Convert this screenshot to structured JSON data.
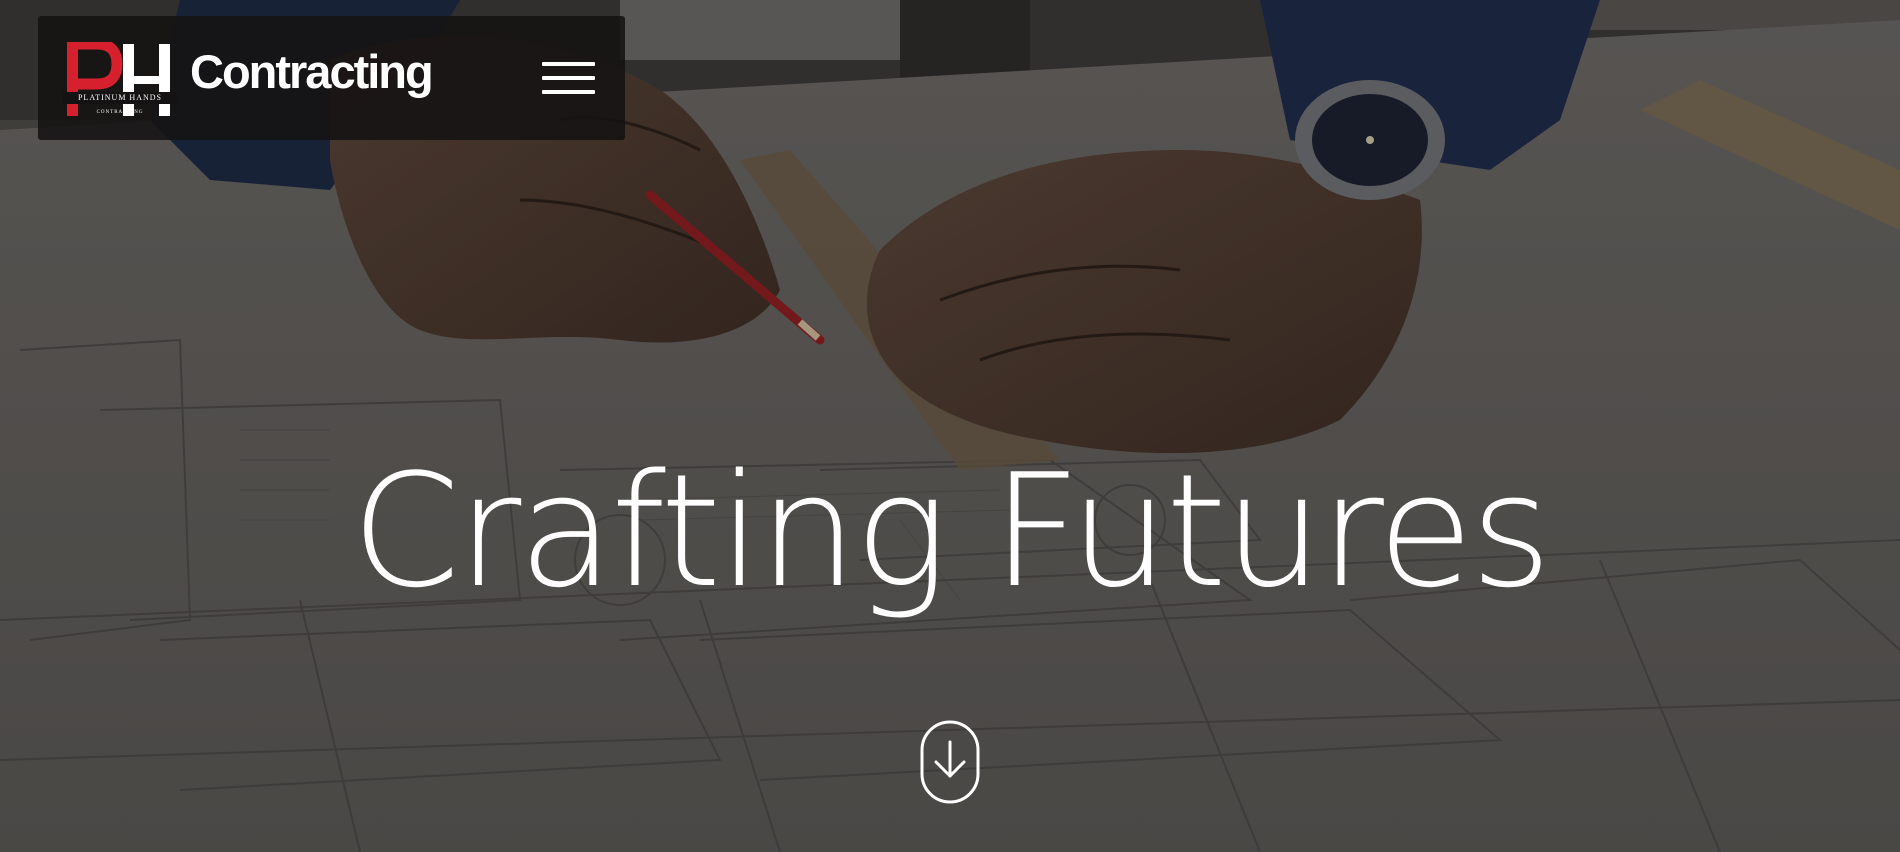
{
  "header": {
    "logo_initials": "PH",
    "logo_tagline": "PLATINUM HANDS",
    "logo_subtag": "CONTRACTING",
    "brand_name": "Contracting",
    "menu_icon": "hamburger-menu-icon"
  },
  "hero": {
    "headline": "Crafting Futures",
    "scroll_icon": "scroll-down-arrow-icon"
  },
  "colors": {
    "navbar_bg": "#141212",
    "logo_accent": "#d6202e",
    "text": "#ffffff"
  }
}
